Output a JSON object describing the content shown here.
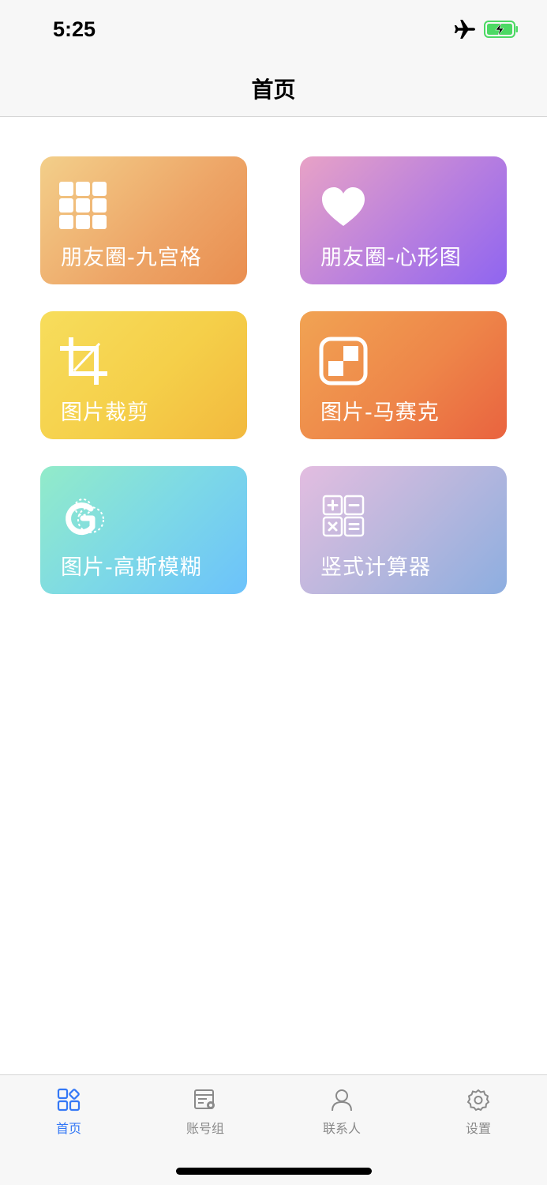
{
  "status": {
    "time": "5:25"
  },
  "nav": {
    "title": "首页"
  },
  "cards": [
    {
      "label": "朋友圈-九宫格",
      "icon": "grid-nine-icon"
    },
    {
      "label": "朋友圈-心形图",
      "icon": "heart-icon"
    },
    {
      "label": "图片裁剪",
      "icon": "crop-icon"
    },
    {
      "label": "图片-马赛克",
      "icon": "mosaic-icon"
    },
    {
      "label": "图片-高斯模糊",
      "icon": "blur-g-icon"
    },
    {
      "label": "竖式计算器",
      "icon": "calculator-icon"
    }
  ],
  "tabs": [
    {
      "label": "首页",
      "icon": "home-grid-icon",
      "active": true
    },
    {
      "label": "账号组",
      "icon": "account-group-icon",
      "active": false
    },
    {
      "label": "联系人",
      "icon": "contact-person-icon",
      "active": false
    },
    {
      "label": "设置",
      "icon": "settings-gear-icon",
      "active": false
    }
  ],
  "colors": {
    "accent": "#3478f6",
    "tab_inactive": "#8a8a8a",
    "battery": "#4cd964"
  }
}
